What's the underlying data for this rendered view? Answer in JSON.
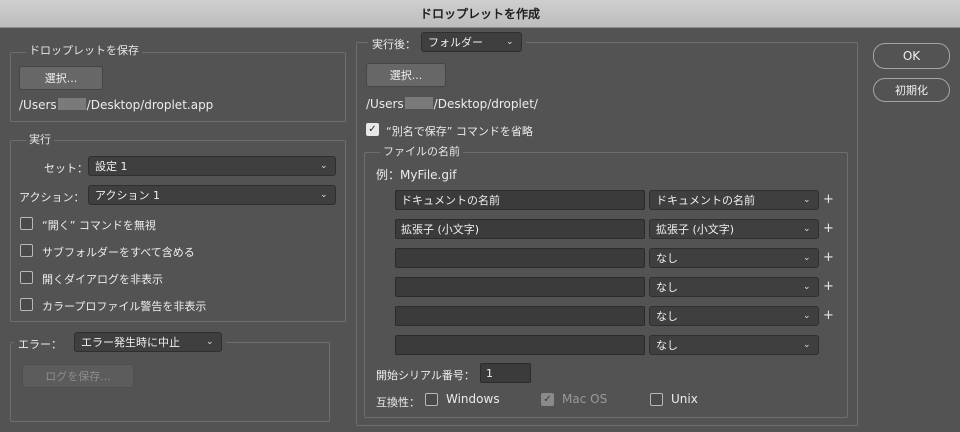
{
  "window": {
    "title": "ドロップレットを作成"
  },
  "save_droplet": {
    "legend": "ドロップレットを保存",
    "choose_label": "選択...",
    "path_prefix": "/Users",
    "path_suffix": "/Desktop/droplet.app"
  },
  "play": {
    "legend": "実行",
    "set_label": "セット：",
    "set_value": "設定 1",
    "action_label": "アクション：",
    "action_value": "アクション 1",
    "options": [
      {
        "label": "“開く” コマンドを無視",
        "checked": false
      },
      {
        "label": "サブフォルダーをすべて含める",
        "checked": false
      },
      {
        "label": "開くダイアログを非表示",
        "checked": false
      },
      {
        "label": "カラープロファイル警告を非表示",
        "checked": false
      }
    ]
  },
  "errors": {
    "label": "エラー：",
    "value": "エラー発生時に中止",
    "save_log_label": "ログを保存..."
  },
  "destination": {
    "label": "実行後：",
    "value": "フォルダー",
    "choose_label": "選択...",
    "path_prefix": "/Users",
    "path_suffix": "/Desktop/droplet/",
    "override_label": "“別名で保存” コマンドを省略",
    "override_checked": true
  },
  "file_naming": {
    "legend": "ファイルの名前",
    "example": "例：MyFile.gif",
    "rows": [
      {
        "text": "ドキュメントの名前",
        "select": "ドキュメントの名前",
        "plus": true
      },
      {
        "text": "拡張子 (小文字)",
        "select": "拡張子 (小文字)",
        "plus": true
      },
      {
        "text": "",
        "select": "なし",
        "plus": true
      },
      {
        "text": "",
        "select": "なし",
        "plus": true
      },
      {
        "text": "",
        "select": "なし",
        "plus": true
      },
      {
        "text": "",
        "select": "なし",
        "plus": false
      }
    ],
    "serial_label": "開始シリアル番号：",
    "serial_value": "1",
    "compat_label": "互換性：",
    "compat": [
      {
        "label": "Windows",
        "checked": false,
        "disabled": false
      },
      {
        "label": "Mac OS",
        "checked": true,
        "disabled": true
      },
      {
        "label": "Unix",
        "checked": false,
        "disabled": false
      }
    ]
  },
  "buttons": {
    "ok": "OK",
    "reset": "初期化"
  },
  "icons": {
    "caret": "chevron-down-icon",
    "check": "checkmark-icon",
    "plus": "plus-icon"
  }
}
